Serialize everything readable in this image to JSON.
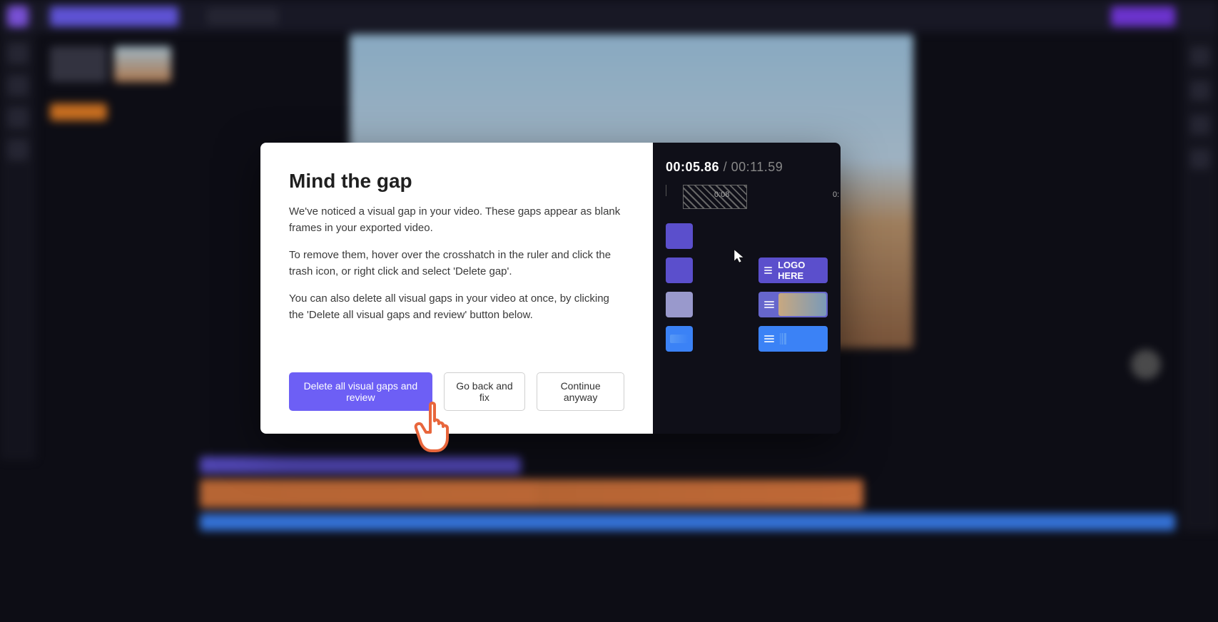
{
  "modal": {
    "title": "Mind the gap",
    "para1": "We've noticed a visual gap in your video. These gaps appear as blank frames in your exported video.",
    "para2": "To remove them, hover over the crosshatch in the ruler and click the trash icon, or right click and select 'Delete gap'.",
    "para3": "You can also delete all visual gaps in your video at once, by clicking the 'Delete all visual gaps and review' button below.",
    "actions": {
      "primary": "Delete all visual gaps and review",
      "secondary": "Go back and fix",
      "tertiary": "Continue anyway"
    }
  },
  "demo": {
    "time_current": "00:05.86",
    "time_sep": " / ",
    "time_total": "00:11.59",
    "ruler_marker1": "0:08",
    "ruler_marker2": "0:",
    "logo_clip_label": "LOGO HERE"
  },
  "colors": {
    "primary": "#6d5ff5",
    "audio": "#3b82f6",
    "subtle_text": "#888"
  }
}
